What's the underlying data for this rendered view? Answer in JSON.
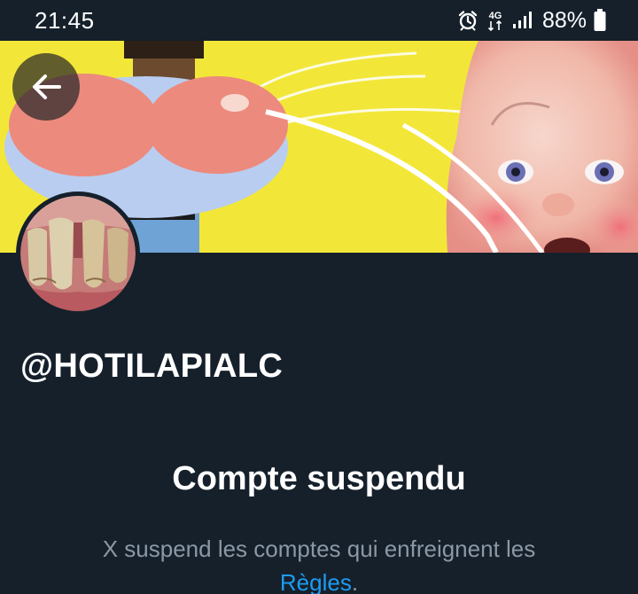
{
  "status_bar": {
    "time": "21:45",
    "network": "4G",
    "battery": "88%"
  },
  "profile": {
    "handle": "@HOTILAPIALC"
  },
  "suspension": {
    "title": "Compte suspendu",
    "description": "X suspend les comptes qui enfreignent les",
    "rules_link": "Règles",
    "period": "."
  },
  "icons": {
    "back": "arrow-left-icon",
    "alarm": "alarm-icon",
    "data": "4g-data-icon",
    "signal": "signal-icon",
    "battery": "battery-icon"
  },
  "colors": {
    "background": "#15202b",
    "secondary_text": "#8b98a5",
    "link": "#1d9bf0"
  }
}
